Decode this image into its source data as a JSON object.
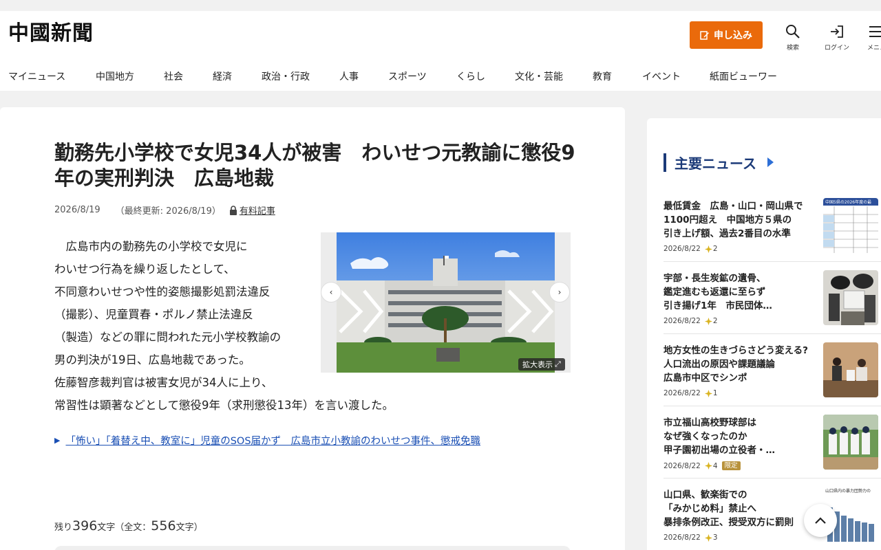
{
  "site": {
    "logo": "中國新聞"
  },
  "header": {
    "apply_label": "申し込み",
    "search_label": "検索",
    "login_label": "ログイン",
    "menu_label": "メニュー"
  },
  "nav": [
    "マイニュース",
    "中国地方",
    "社会",
    "経済",
    "政治・行政",
    "人事",
    "スポーツ",
    "くらし",
    "文化・芸能",
    "教育",
    "イベント",
    "紙面ビューワー"
  ],
  "article": {
    "title": "勤務先小学校で女児34人が被害　わいせつ元教諭に懲役9年の実刑判決　広島地裁",
    "date": "2026/8/19",
    "updated": "（最終更新: 2026/8/19）",
    "paid_label": "有料記事",
    "body_lines": [
      "　広島市内の勤務先の小学校で女児に",
      "わいせつ行為を繰り返したとして、",
      "不同意わいせつや性的姿態撮影処罰法違反",
      "（撮影）、児童買春・ポルノ禁止法違反",
      "（製造）などの罪に問われた元小学校教諭の",
      "男の判決が19日、広島地裁であった。",
      "佐藤智彦裁判官は被害女児が34人に上り、",
      "常習性は顕著などとして懲役9年（求刑懲役13年）を言い渡した。"
    ],
    "photo_zoom_label": "拡大表示",
    "related_link": "「怖い」「着替え中、教室に」児童のSOS届かず　広島市立小教諭のわいせつ事件、懲戒免職",
    "remaining_prefix": "残り",
    "remaining_count": "396",
    "remaining_mid": "文字（全文：",
    "total_count": "556",
    "remaining_suffix": "文字）"
  },
  "sidebar": {
    "heading": "主要ニュース",
    "items": [
      {
        "title_lines": [
          "最低賃金　広島・山口・岡山県で",
          "1100円超え　中国地方５県の",
          "引き上げ額、過去2番目の水準"
        ],
        "date": "2026/8/22",
        "stars": "2",
        "badge": ""
      },
      {
        "title_lines": [
          "宇部・長生炭鉱の遺骨、",
          "鑑定進むも返還に至らず",
          "引き揚げ1年　市民団体…"
        ],
        "date": "2026/8/22",
        "stars": "2",
        "badge": ""
      },
      {
        "title_lines": [
          "地方女性の生きづらさどう変える?",
          "人口流出の原因や課題議論",
          "広島市中区でシンポ"
        ],
        "date": "2026/8/22",
        "stars": "1",
        "badge": ""
      },
      {
        "title_lines": [
          "市立福山高校野球部は",
          "なぜ強くなったのか",
          "甲子園初出場の立役者・…"
        ],
        "date": "2026/8/22",
        "stars": "4",
        "badge": "限定"
      },
      {
        "title_lines": [
          "山口県、歓楽街での",
          "「みかじめ料」禁止へ",
          "暴排条例改正、授受双方に罰則"
        ],
        "date": "2026/8/22",
        "stars": "3",
        "badge": ""
      }
    ],
    "thumb_texts": [
      "中国5県の2026年度の最",
      "山口県内の暴力団勢力の"
    ]
  },
  "colors": {
    "accent_orange": "#ea6a0b",
    "navy": "#1b3a78",
    "link_blue": "#1a4fb4",
    "star_gold": "#d9b320"
  }
}
